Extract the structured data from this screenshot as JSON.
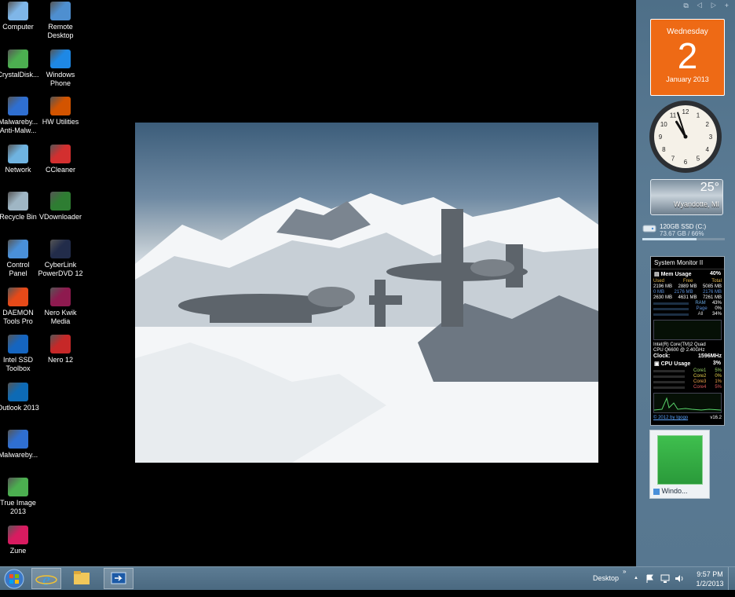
{
  "desktop": {
    "icons": [
      {
        "label": "Computer",
        "color": "#7fb6e8"
      },
      {
        "label": "Remote\nDesktop",
        "color": "#4e8fd0"
      },
      {
        "label": "CrystalDisk...",
        "color": "#4caf50"
      },
      {
        "label": "Windows\nPhone",
        "color": "#1e88e5"
      },
      {
        "label": "Malwareby...\nAnti-Malw...",
        "color": "#2f6fd1"
      },
      {
        "label": "HW Utilities",
        "color": "#d35400"
      },
      {
        "label": "Network",
        "color": "#6fb3e0"
      },
      {
        "label": "CCleaner",
        "color": "#d32f2f"
      },
      {
        "label": "Recycle Bin",
        "color": "#9fb6c4"
      },
      {
        "label": "VDownloader",
        "color": "#2e7d32"
      },
      {
        "label": "Control\nPanel",
        "color": "#4a90d9"
      },
      {
        "label": "CyberLink\nPowerDVD 12",
        "color": "#222c4a"
      },
      {
        "label": "DAEMON\nTools Pro",
        "color": "#e64a19"
      },
      {
        "label": "Nero Kwik\nMedia",
        "color": "#8e1a4f"
      },
      {
        "label": "Intel SSD\nToolbox",
        "color": "#1565c0"
      },
      {
        "label": "Nero 12",
        "color": "#c62828"
      },
      {
        "label": "Outlook 2013",
        "color": "#0d6ab5"
      },
      {
        "label": "Malwareby...",
        "color": "#2f6fd1"
      },
      {
        "label": "True Image\n2013",
        "color": "#4caf50"
      },
      {
        "label": "Zune",
        "color": "#d81b60"
      }
    ]
  },
  "gadgets": {
    "controls": "⧉ ◁ ▷ +",
    "calendar": {
      "weekday": "Wednesday",
      "day": "2",
      "month": "January 2013"
    },
    "clock": {
      "hour": 10,
      "minute": 57
    },
    "weather": {
      "temp": "25°",
      "location": "Wyandotte, MI"
    },
    "drive": {
      "name": "120GB SSD (C:)",
      "free": "73.67 GB / 66%",
      "fill": 0.66
    },
    "sysmon": {
      "title": "System Monitor II",
      "mem_label": "Mem Usage",
      "mem_pct": "40%",
      "mem_headers": [
        "Used",
        "Free",
        "Total"
      ],
      "mem_rows": [
        [
          "2196 MB",
          "2889 MB",
          "5085 MB"
        ],
        [
          "0 MB",
          "2176 MB",
          "2176 MB"
        ],
        [
          "2630 MB",
          "4631 MB",
          "7261 MB"
        ]
      ],
      "mem_types": [
        [
          "RAM",
          "43%"
        ],
        [
          "Page",
          "0%"
        ],
        [
          "All",
          "34%"
        ]
      ],
      "cpu_name": "Intel(R) Core(TM)2 Quad",
      "cpu_model": "CPU   Q6600 @ 2.40GHz",
      "clock_label": "Clock:",
      "clock_value": "1596MHz",
      "cpu_label": "CPU Usage",
      "cpu_pct": "3%",
      "cores": [
        [
          "Core1",
          "5%"
        ],
        [
          "Core2",
          "0%"
        ],
        [
          "Core3",
          "1%"
        ],
        [
          "Core4",
          "5%"
        ]
      ],
      "footer_link": "© 2012 by Igogo",
      "version": "v16.2"
    },
    "window_thumb_label": "Windo..."
  },
  "taskbar": {
    "desktop_label": "Desktop",
    "time": "9:57 PM",
    "date": "1/2/2013",
    "chevron": "»",
    "up_arrow": "▲"
  },
  "colors": {
    "accent_orange": "#ee6a15",
    "taskbar": "#4f6e86"
  }
}
